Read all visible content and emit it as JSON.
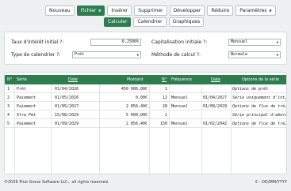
{
  "toolbar": {
    "nouveau": "Nouveau",
    "fichier": "Fichier",
    "inserer": "Insérer",
    "supprimer": "Supprimer",
    "developper": "Développer",
    "reduire": "Réduire",
    "parametres": "Paramètres"
  },
  "tabs": {
    "calculer": "Calculer",
    "calendrier": "Calendrier",
    "graphiques": "Graphiques"
  },
  "form": {
    "taux_label": "Taux d'intérêt initial ?:",
    "taux_value": "6,2500%",
    "cap_label": "Capitalisation initiale ?:",
    "cap_value": "Mensuel",
    "cal_label": "Type de calendrier ?:",
    "cal_value": "Prêt",
    "calc_label": "Méthode de calcul ?:",
    "calc_value": "Normale"
  },
  "table": {
    "headers": {
      "num": "N°",
      "serie": "Série",
      "date": "Date",
      "montant": "Montant",
      "n": "N°",
      "frequence": "Fréquence",
      "date2": "Date",
      "options": "Options de la série"
    },
    "rows": [
      {
        "num": "1",
        "serie": "Prêt",
        "date": "01/04/2026",
        "montant": "450 000,00€",
        "n": "1",
        "freq": "",
        "date2": "",
        "opt": "Options de prêt"
      },
      {
        "num": "2",
        "serie": "Paiement",
        "date": "01/05/2026",
        "montant": "0,00€",
        "n": "12",
        "freq": "Mensuel",
        "date2": "01/04/2027",
        "opt": "Série uniquement d'int…"
      },
      {
        "num": "3",
        "serie": "Paiement",
        "date": "01/05/2027",
        "montant": "2 856,40€",
        "n": "28",
        "freq": "Mensuel",
        "date2": "01/08/2029",
        "opt": "Options de flux de tré…"
      },
      {
        "num": "4",
        "serie": "Xtra Pmt",
        "date": "15/08/2029",
        "montant": "5 000,00€",
        "n": "1",
        "freq": "",
        "date2": "",
        "opt": "Série principal d'abord"
      },
      {
        "num": "5",
        "serie": "Paiement",
        "date": "01/09/2029",
        "montant": "2 856,40€",
        "n": "150",
        "freq": "Mensuel",
        "date2": "01/02/2042",
        "opt": "Options de flux de tré…"
      }
    ]
  },
  "footer": {
    "copyright": "©2026 Pine Grove Software LLC., all rights reserved.",
    "format": "€ : DD/MM/YYYY"
  },
  "colors": {
    "accent": "#2e7d4f"
  }
}
